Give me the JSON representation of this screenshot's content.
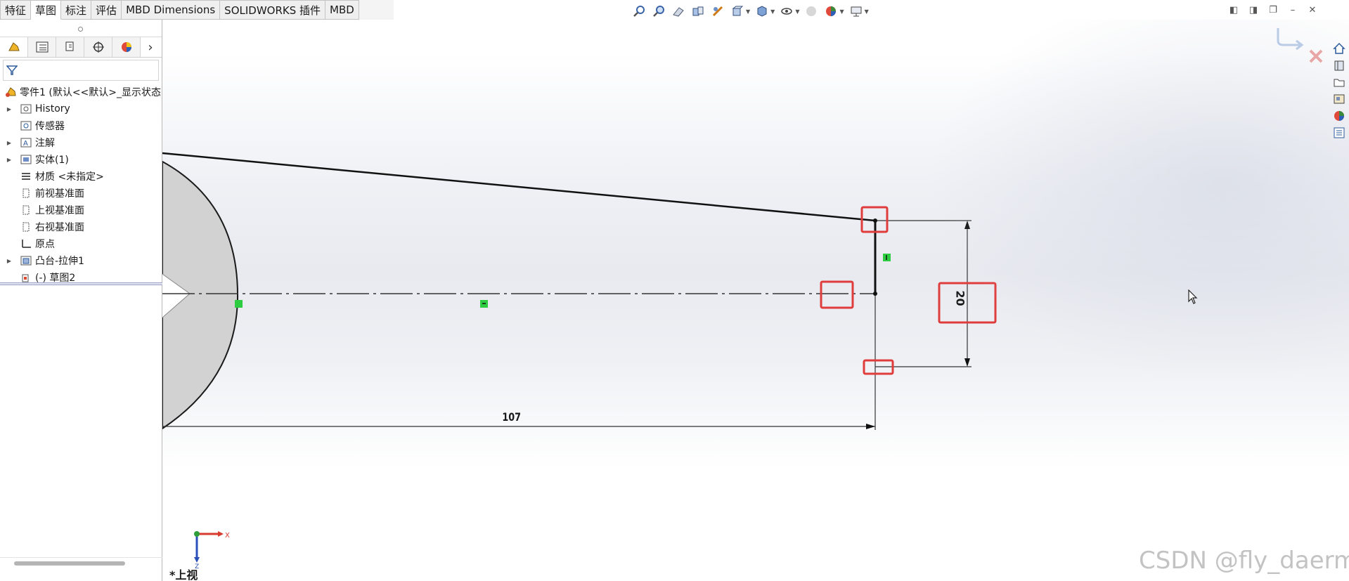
{
  "command_tabs": [
    {
      "label": "特征",
      "active": false
    },
    {
      "label": "草图",
      "active": true
    },
    {
      "label": "标注",
      "active": false
    },
    {
      "label": "评估",
      "active": false
    },
    {
      "label": "MBD Dimensions",
      "active": false
    },
    {
      "label": "SOLIDWORKS 插件",
      "active": false
    },
    {
      "label": "MBD",
      "active": false
    }
  ],
  "panel_tabs": [
    "featuremanager-icon",
    "propertymanager-icon",
    "configurationmanager-icon",
    "dimxpert-icon",
    "display-manager-icon"
  ],
  "feature_tree": {
    "root": "零件1 (默认<<默认>_显示状态",
    "items": [
      {
        "label": "History",
        "icon": "history-icon",
        "expandable": true
      },
      {
        "label": "传感器",
        "icon": "sensor-icon",
        "expandable": false
      },
      {
        "label": "注解",
        "icon": "annotation-icon",
        "expandable": true
      },
      {
        "label": "实体(1)",
        "icon": "solid-body-icon",
        "expandable": true
      },
      {
        "label": "材质 <未指定>",
        "icon": "material-icon",
        "expandable": false
      },
      {
        "label": "前视基准面",
        "icon": "plane-icon",
        "expandable": false
      },
      {
        "label": "上视基准面",
        "icon": "plane-icon",
        "expandable": false
      },
      {
        "label": "右视基准面",
        "icon": "plane-icon",
        "expandable": false
      },
      {
        "label": "原点",
        "icon": "origin-icon",
        "expandable": false
      },
      {
        "label": "凸台-拉伸1",
        "icon": "boss-extrude-icon",
        "expandable": true
      },
      {
        "label": "(-) 草图2",
        "icon": "sketch-icon",
        "expandable": false
      }
    ]
  },
  "viewport": {
    "view_name": "*上视",
    "dimension_horizontal": "107",
    "dimension_vertical": "20",
    "triad_axes": [
      "X",
      "Z"
    ],
    "highlight_color": "#e03c3c",
    "relation_color": "#2ecc40"
  },
  "watermark": "CSDN @fly_daerm"
}
